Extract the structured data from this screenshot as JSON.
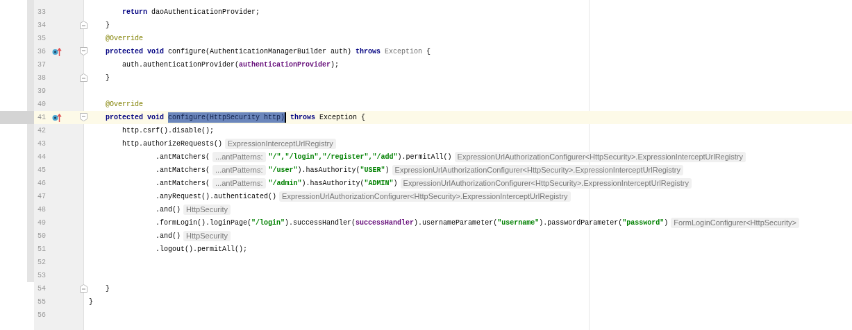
{
  "editor": {
    "lines": [
      {
        "number": "33",
        "tokens": [
          {
            "kind": "keyword",
            "text": "        return "
          },
          {
            "kind": "plain",
            "text": "daoAuthenticationProvider;"
          }
        ]
      },
      {
        "number": "34",
        "fold_end": true,
        "tokens": [
          {
            "kind": "plain",
            "text": "    }"
          }
        ]
      },
      {
        "number": "35",
        "tokens": [
          {
            "kind": "annotation",
            "text": "    @Override"
          }
        ]
      },
      {
        "number": "36",
        "overrides": true,
        "fold_start": true,
        "tokens": [
          {
            "kind": "keyword",
            "text": "    protected void "
          },
          {
            "kind": "plain",
            "text": "configure(AuthenticationManagerBuilder auth) "
          },
          {
            "kind": "keyword",
            "text": "throws "
          },
          {
            "kind": "muted",
            "text": "Exception"
          },
          {
            "kind": "plain",
            "text": " {"
          }
        ]
      },
      {
        "number": "37",
        "tokens": [
          {
            "kind": "plain",
            "text": "        auth.authenticationProvider("
          },
          {
            "kind": "field",
            "text": "authenticationProvider"
          },
          {
            "kind": "plain",
            "text": ");"
          }
        ]
      },
      {
        "number": "38",
        "fold_end": true,
        "tokens": [
          {
            "kind": "plain",
            "text": "    }"
          }
        ]
      },
      {
        "number": "39"
      },
      {
        "number": "40",
        "tokens": [
          {
            "kind": "annotation",
            "text": "    @Override"
          }
        ]
      },
      {
        "number": "41",
        "current": true,
        "overrides": true,
        "fold_start": true,
        "tokens": [
          {
            "kind": "keyword",
            "text": "    protected void "
          },
          {
            "kind": "selected",
            "text": "configure(HttpSecurity http)"
          },
          {
            "kind": "keyword",
            "text": " throws "
          },
          {
            "kind": "plain",
            "text": "Exception {"
          }
        ]
      },
      {
        "number": "42",
        "tokens": [
          {
            "kind": "plain",
            "text": "        http.csrf().disable();"
          }
        ]
      },
      {
        "number": "43",
        "tokens": [
          {
            "kind": "plain",
            "text": "        http.authorizeRequests()"
          },
          {
            "kind": "hint",
            "text": "ExpressionInterceptUrlRegistry"
          }
        ]
      },
      {
        "number": "44",
        "tokens": [
          {
            "kind": "plain",
            "text": "                .antMatchers("
          },
          {
            "kind": "hint",
            "text": "...antPatterns:"
          },
          {
            "kind": "string",
            "text": "\"/\",\"/login\",\"/register\",\"/add\""
          },
          {
            "kind": "plain",
            "text": ").permitAll()"
          },
          {
            "kind": "hint",
            "text": "ExpressionUrlAuthorizationConfigurer<HttpSecurity>.ExpressionInterceptUrlRegistry"
          }
        ]
      },
      {
        "number": "45",
        "tokens": [
          {
            "kind": "plain",
            "text": "                .antMatchers("
          },
          {
            "kind": "hint",
            "text": "...antPatterns:"
          },
          {
            "kind": "string",
            "text": "\"/user\""
          },
          {
            "kind": "plain",
            "text": ").hasAuthority("
          },
          {
            "kind": "string",
            "text": "\"USER\""
          },
          {
            "kind": "plain",
            "text": ")"
          },
          {
            "kind": "hint",
            "text": "ExpressionUrlAuthorizationConfigurer<HttpSecurity>.ExpressionInterceptUrlRegistry"
          }
        ]
      },
      {
        "number": "46",
        "tokens": [
          {
            "kind": "plain",
            "text": "                .antMatchers("
          },
          {
            "kind": "hint",
            "text": "...antPatterns:"
          },
          {
            "kind": "string",
            "text": "\"/admin\""
          },
          {
            "kind": "plain",
            "text": ").hasAuthority("
          },
          {
            "kind": "string",
            "text": "\"ADMIN\""
          },
          {
            "kind": "plain",
            "text": ")"
          },
          {
            "kind": "hint",
            "text": "ExpressionUrlAuthorizationConfigurer<HttpSecurity>.ExpressionInterceptUrlRegistry"
          }
        ]
      },
      {
        "number": "47",
        "tokens": [
          {
            "kind": "plain",
            "text": "                .anyRequest().authenticated()"
          },
          {
            "kind": "hint",
            "text": "ExpressionUrlAuthorizationConfigurer<HttpSecurity>.ExpressionInterceptUrlRegistry"
          }
        ]
      },
      {
        "number": "48",
        "tokens": [
          {
            "kind": "plain",
            "text": "                .and()"
          },
          {
            "kind": "hint",
            "text": "HttpSecurity"
          }
        ]
      },
      {
        "number": "49",
        "tokens": [
          {
            "kind": "plain",
            "text": "                .formLogin().loginPage("
          },
          {
            "kind": "string",
            "text": "\"/login\""
          },
          {
            "kind": "plain",
            "text": ").successHandler("
          },
          {
            "kind": "field",
            "text": "successHandler"
          },
          {
            "kind": "plain",
            "text": ").usernameParameter("
          },
          {
            "kind": "string",
            "text": "\"username\""
          },
          {
            "kind": "plain",
            "text": ").passwordParameter("
          },
          {
            "kind": "string",
            "text": "\"password\""
          },
          {
            "kind": "plain",
            "text": ")"
          },
          {
            "kind": "hint",
            "text": "FormLoginConfigurer<HttpSecurity>"
          }
        ]
      },
      {
        "number": "50",
        "tokens": [
          {
            "kind": "plain",
            "text": "                .and()"
          },
          {
            "kind": "hint",
            "text": "HttpSecurity"
          }
        ]
      },
      {
        "number": "51",
        "tokens": [
          {
            "kind": "plain",
            "text": "                .logout().permitAll();"
          }
        ]
      },
      {
        "number": "52"
      },
      {
        "number": "53"
      },
      {
        "number": "54",
        "fold_end": true,
        "tokens": [
          {
            "kind": "plain",
            "text": "    }"
          }
        ]
      },
      {
        "number": "55",
        "tokens": [
          {
            "kind": "plain",
            "text": "}"
          }
        ]
      },
      {
        "number": "56"
      }
    ]
  }
}
